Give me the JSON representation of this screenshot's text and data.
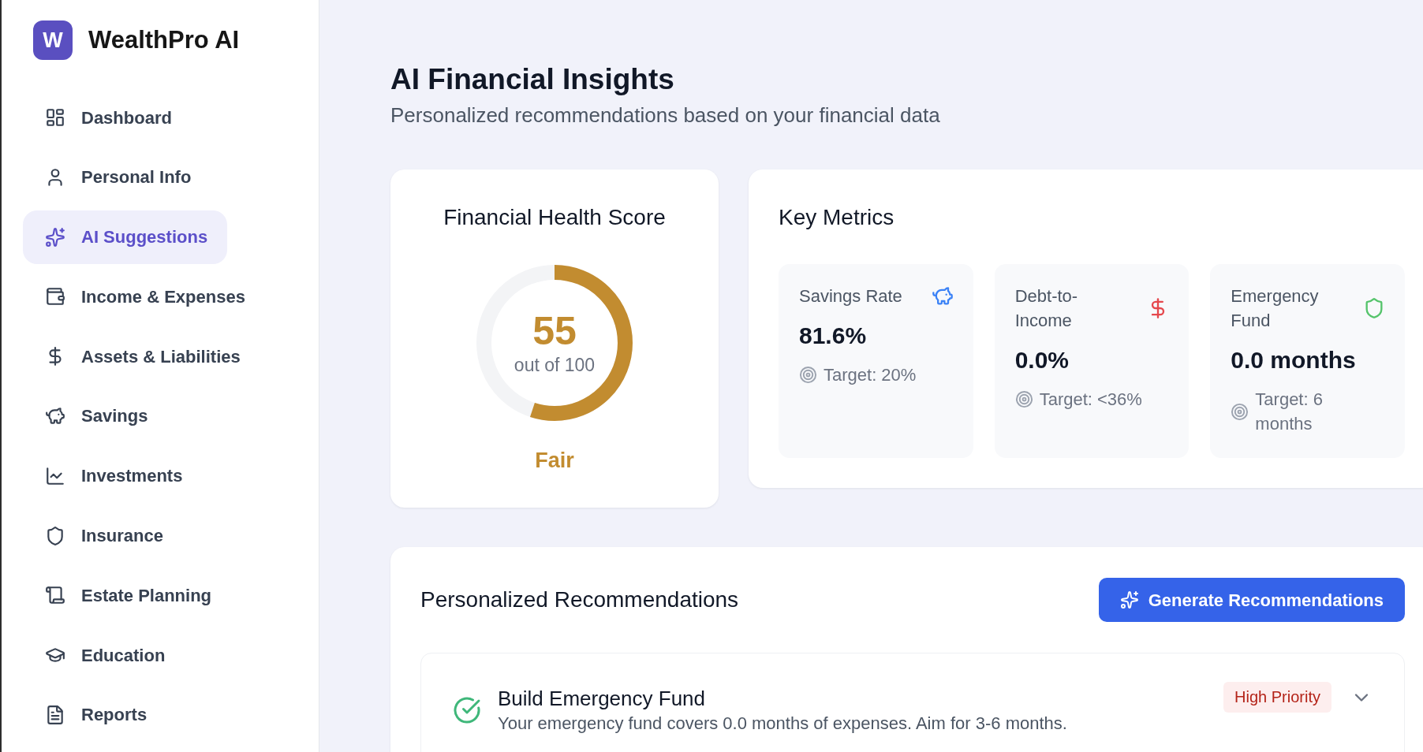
{
  "sidebar": {
    "logo": {
      "letter": "W",
      "name": "WealthPro AI"
    },
    "items": [
      {
        "label": "Dashboard",
        "selected": false
      },
      {
        "label": "Personal Info",
        "selected": false
      },
      {
        "label": "AI Suggestions",
        "selected": true
      },
      {
        "label": "Income & Expenses",
        "selected": false
      },
      {
        "label": "Assets & Liabilities",
        "selected": false
      },
      {
        "label": "Savings",
        "selected": false
      },
      {
        "label": "Investments",
        "selected": false
      },
      {
        "label": "Insurance",
        "selected": false
      },
      {
        "label": "Estate Planning",
        "selected": false
      },
      {
        "label": "Education",
        "selected": false
      },
      {
        "label": "Reports",
        "selected": false
      }
    ]
  },
  "header": {
    "title": "AI Financial Insights",
    "subtitle": "Personalized recommendations based on your financial data"
  },
  "score_card": {
    "title": "Financial Health Score",
    "score": "55",
    "caption": "out of 100",
    "level": 0.55,
    "rating": "Fair"
  },
  "key_metrics": {
    "title": "Key Metrics",
    "items": [
      {
        "label": "Savings Rate",
        "value": "81.6%",
        "target": "Target: 20%",
        "color": "#3b82f6"
      },
      {
        "label": "Debt-to-Income",
        "value": "0.0%",
        "target": "Target: <36%",
        "color": "#e5484d"
      },
      {
        "label": "Emergency Fund",
        "value": "0.0 months",
        "target": "Target: 6 months",
        "color": "#55c46b"
      }
    ]
  },
  "recommendations": {
    "title": "Personalized Recommendations",
    "button": "Generate Recommendations",
    "items": [
      {
        "title": "Build Emergency Fund",
        "description": "Your emergency fund covers 0.0 months of expenses. Aim for 3-6 months.",
        "priority": "High Priority",
        "expanded": false
      }
    ]
  }
}
